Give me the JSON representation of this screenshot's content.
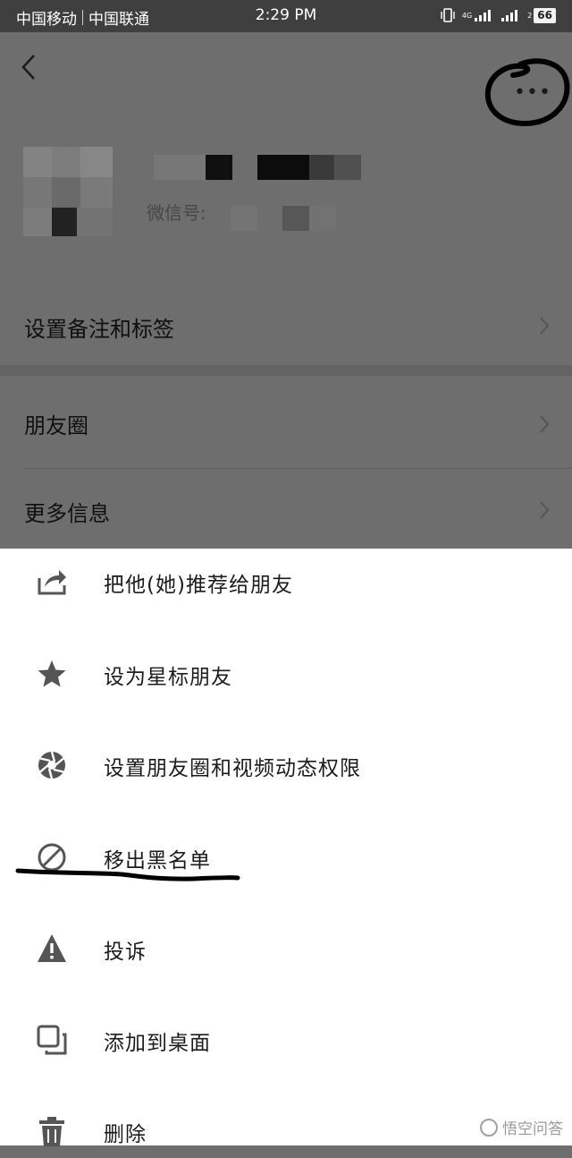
{
  "status_bar": {
    "carrier1": "中国移动",
    "carrier2": "中国联通",
    "time": "2:29 PM",
    "network1": "4G",
    "network2": "2",
    "battery": "66"
  },
  "profile": {
    "wechat_id_label": "微信号:",
    "rows": [
      {
        "label": "设置备注和标签"
      },
      {
        "label": "朋友圈"
      },
      {
        "label": "更多信息"
      }
    ]
  },
  "menu": {
    "items": [
      {
        "label": "把他(她)推荐给朋友",
        "icon": "share-icon"
      },
      {
        "label": "设为星标朋友",
        "icon": "star-icon"
      },
      {
        "label": "设置朋友圈和视频动态权限",
        "icon": "aperture-icon"
      },
      {
        "label": "移出黑名单",
        "icon": "block-icon"
      },
      {
        "label": "投诉",
        "icon": "warning-icon"
      },
      {
        "label": "添加到桌面",
        "icon": "add-to-desktop-icon"
      },
      {
        "label": "删除",
        "icon": "trash-icon"
      }
    ]
  },
  "watermark": "悟空问答",
  "colors": {
    "sheet_background": "#ffffff",
    "overlay": "#6e6e6e",
    "status_bar": "#3f3f3f",
    "icon_gray": "#555555"
  }
}
